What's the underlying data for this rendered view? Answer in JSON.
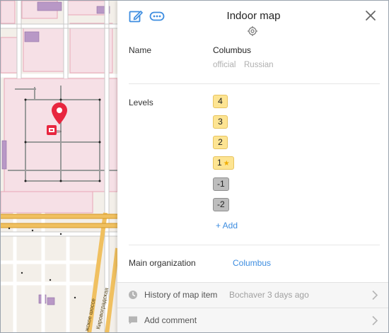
{
  "header": {
    "title": "Indoor map"
  },
  "name_section": {
    "label": "Name",
    "value": "Columbus",
    "sub_official": "official",
    "sub_language": "Russian"
  },
  "levels_section": {
    "label": "Levels",
    "levels": [
      {
        "label": "4",
        "kind": "yellow"
      },
      {
        "label": "3",
        "kind": "yellow"
      },
      {
        "label": "2",
        "kind": "yellow"
      },
      {
        "label": "1",
        "kind": "yellow",
        "default": true
      },
      {
        "label": "-1",
        "kind": "gray"
      },
      {
        "label": "-2",
        "kind": "gray"
      }
    ],
    "add_label": "+ Add"
  },
  "organization_section": {
    "label": "Main organization",
    "value": "Columbus"
  },
  "footer": {
    "history_label": "History of map item",
    "history_meta": "Bochaver 3 days ago",
    "comment_label": "Add comment"
  },
  "map": {
    "street_label_1": "Кировоградская",
    "street_label_2": "жское шоссе"
  },
  "colors": {
    "accent": "#3d8de0",
    "level_yellow": "#fde492",
    "level_gray": "#bdbdbd",
    "pin": "#e8263f"
  },
  "icons": [
    "edit-icon",
    "more-icon",
    "close-icon",
    "drag-handle-icon",
    "map-pin-icon",
    "clock-icon",
    "comment-icon",
    "chevron-right-icon",
    "star-icon"
  ]
}
